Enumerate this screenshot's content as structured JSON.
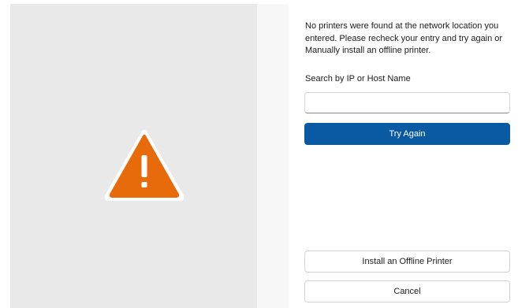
{
  "dialog": {
    "message": "No printers were found at the network location you entered. Please recheck your entry and try again or Manually install an offline printer.",
    "search": {
      "label": "Search by IP or Host Name",
      "value": "",
      "placeholder": ""
    },
    "try_again_label": "Try Again",
    "install_offline_label": "Install an Offline Printer",
    "cancel_label": "Cancel",
    "icon": "warning-icon"
  },
  "colors": {
    "accent": "#0a5aa3",
    "warning": "#e76b0a",
    "left_panel_bg": "#e9e9e9"
  }
}
